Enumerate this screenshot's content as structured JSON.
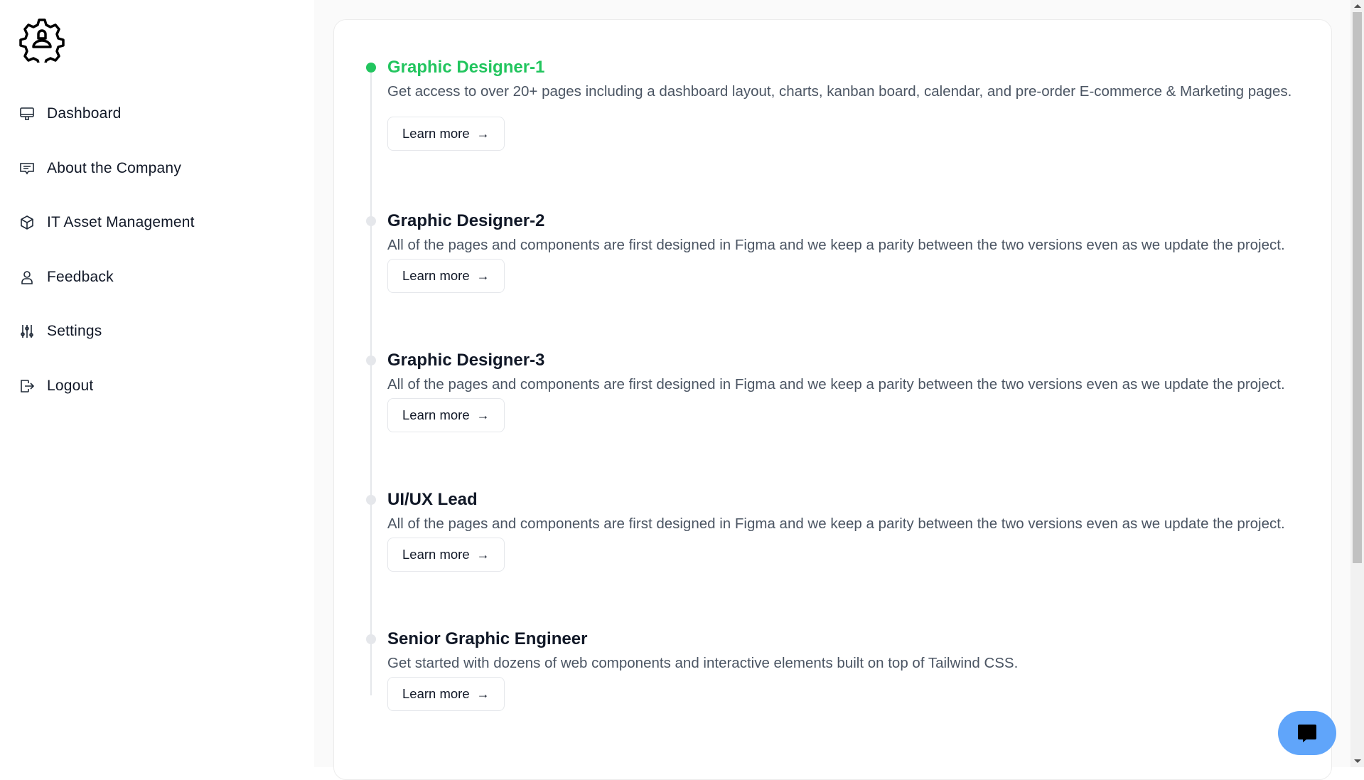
{
  "sidebar": {
    "items": [
      {
        "label": "Dashboard",
        "icon": "monitor-icon"
      },
      {
        "label": "About the Company",
        "icon": "message-icon"
      },
      {
        "label": "IT Asset Management",
        "icon": "cube-icon"
      },
      {
        "label": "Feedback",
        "icon": "user-icon"
      },
      {
        "label": "Settings",
        "icon": "sliders-icon"
      },
      {
        "label": "Logout",
        "icon": "logout-icon"
      }
    ]
  },
  "timeline": [
    {
      "title": "Graphic Designer-1",
      "desc": "Get access to over 20+ pages including a dashboard layout, charts, kanban board, calendar, and pre-order E-commerce & Marketing pages.",
      "button": "Learn more",
      "active": true
    },
    {
      "title": "Graphic Designer-2",
      "desc": "All of the pages and components are first designed in Figma and we keep a parity between the two versions even as we update the project.",
      "button": "Learn more"
    },
    {
      "title": "Graphic Designer-3",
      "desc": "All of the pages and components are first designed in Figma and we keep a parity between the two versions even as we update the project.",
      "button": "Learn more"
    },
    {
      "title": "UI/UX Lead",
      "desc": "All of the pages and components are first designed in Figma and we keep a parity between the two versions even as we update the project.",
      "button": "Learn more"
    },
    {
      "title": "Senior Graphic Engineer",
      "desc": "Get started with dozens of web components and interactive elements built on top of Tailwind CSS.",
      "button": "Learn more"
    }
  ],
  "colors": {
    "active": "#22c55e",
    "chat": "#60a5fa"
  }
}
